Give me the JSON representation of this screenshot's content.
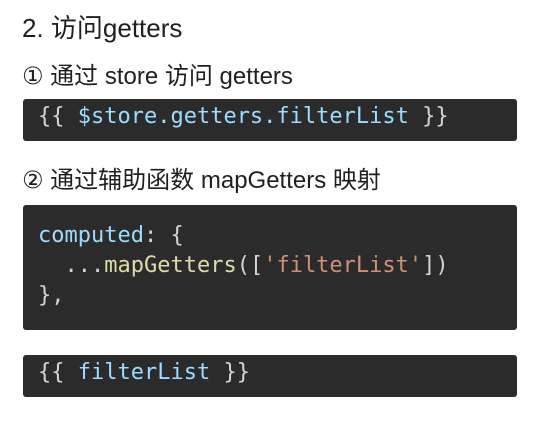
{
  "section_title": "2. 访问getters",
  "method_one": {
    "title": "① 通过 store 访问 getters",
    "code": {
      "open": "{{ ",
      "expression": "$store.getters.filterList",
      "close": " }}"
    }
  },
  "method_two": {
    "title": "② 通过辅助函数 mapGetters 映射",
    "code": {
      "line1_key": "computed",
      "line1_rest": ": {",
      "line2_indent": "  ",
      "line2_spread": "...",
      "line2_fn": "mapGetters",
      "line2_open": "([",
      "line2_string": "'filterList'",
      "line2_close": "])",
      "line3": "},"
    }
  },
  "template_usage": {
    "open": "{{ ",
    "expression": "filterList",
    "close": " }}"
  }
}
